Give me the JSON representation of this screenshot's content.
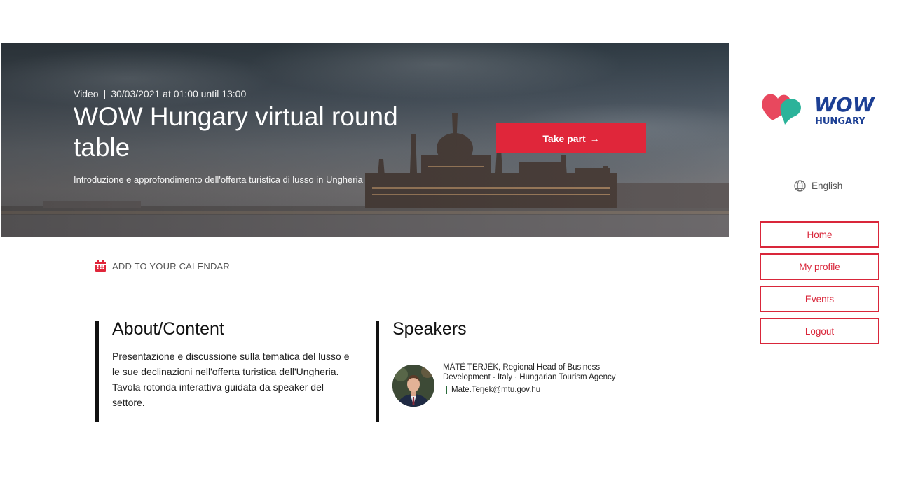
{
  "hero": {
    "type": "Video",
    "date": "30/03/2021 at 01:00 until 13:00",
    "title": "WOW Hungary virtual round table",
    "subtitle": "Introduzione e approfondimento dell'offerta turistica di lusso in Ungheria",
    "cta_label": "Take part",
    "cta_arrow": "→"
  },
  "calendar": {
    "label": "ADD TO YOUR CALENDAR",
    "icon": "calendar-icon"
  },
  "about": {
    "heading": "About/Content",
    "text": "Presentazione e discussione sulla tematica del lusso e le sue declinazioni nell'offerta turistica dell'Ungheria. Tavola rotonda interattiva guidata da speaker del settore."
  },
  "speakers": {
    "heading": "Speakers",
    "items": [
      {
        "name": "MÁTÉ TERJÉK, Regional Head of Business Development - Italy · Hungarian Tourism Agency",
        "email": "Mate.Terjek@mtu.gov.hu"
      }
    ]
  },
  "sidebar": {
    "logo_line1": "WOW",
    "logo_line2": "HUNGARY",
    "language": "English",
    "nav": [
      "Home",
      "My profile",
      "Events",
      "Logout"
    ]
  },
  "colors": {
    "accent": "#e0263a",
    "logo_blue": "#1c3f94",
    "logo_pink": "#e8485e",
    "logo_teal": "#2bb39a"
  }
}
